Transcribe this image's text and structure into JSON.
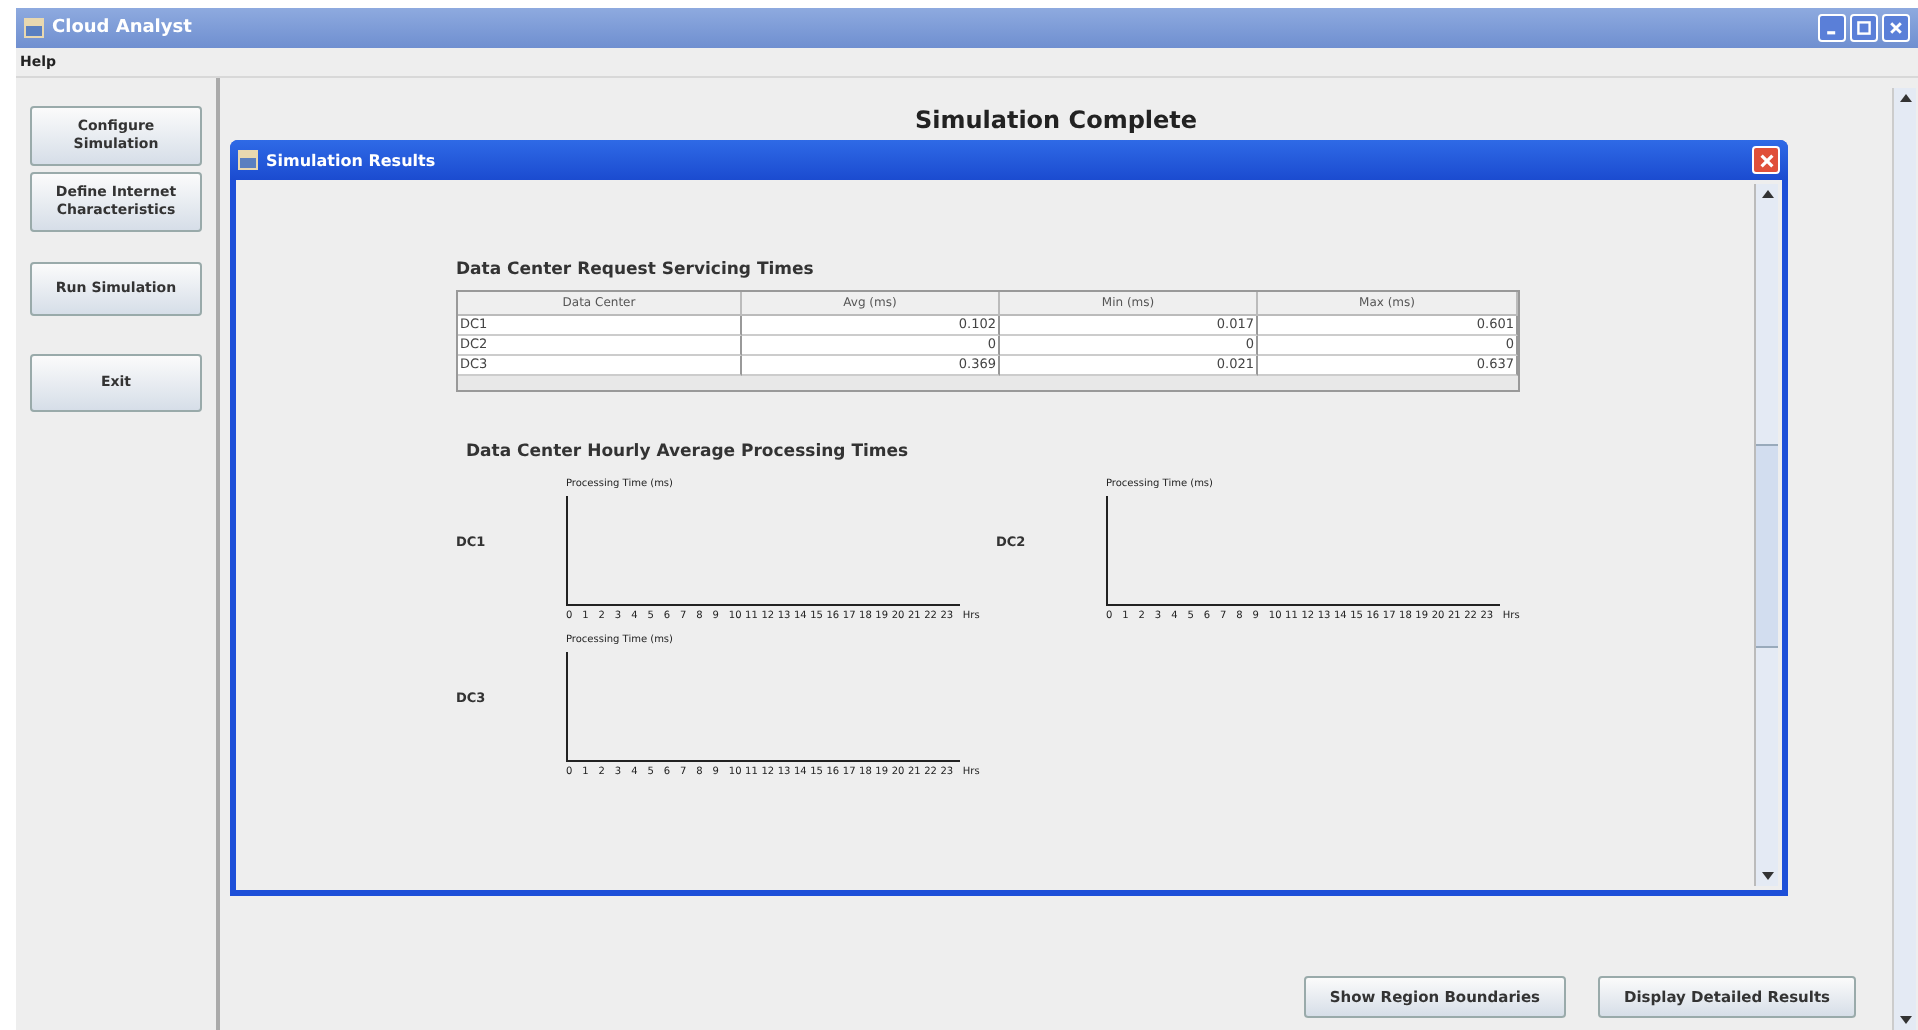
{
  "window": {
    "title": "Cloud Analyst"
  },
  "menu": [
    "Help"
  ],
  "sidebar_buttons": [
    "Configure Simulation",
    "Define Internet Characteristics",
    "Run Simulation",
    "Exit"
  ],
  "main_title": "Simulation Complete",
  "dialog": {
    "title": "Simulation Results",
    "servicing": {
      "title": "Data Center Request Servicing Times",
      "columns": [
        "Data Center",
        "Avg (ms)",
        "Min (ms)",
        "Max (ms)"
      ],
      "rows": [
        [
          "DC1",
          "0.102",
          "0.017",
          "0.601"
        ],
        [
          "DC2",
          "0",
          "0",
          "0"
        ],
        [
          "DC3",
          "0.369",
          "0.021",
          "0.637"
        ]
      ]
    },
    "hourly": {
      "title": "Data Center Hourly Average Processing Times",
      "charts": [
        {
          "label": "DC1",
          "y_title": "Processing Time (ms)",
          "x_unit": "Hrs",
          "x_ticks": [
            "0",
            "1",
            "2",
            "3",
            "4",
            "5",
            "6",
            "7",
            "8",
            "9",
            "10",
            "11",
            "12",
            "13",
            "14",
            "15",
            "16",
            "17",
            "18",
            "19",
            "20",
            "21",
            "22",
            "23"
          ]
        },
        {
          "label": "DC2",
          "y_title": "Processing Time (ms)",
          "x_unit": "Hrs",
          "x_ticks": [
            "0",
            "1",
            "2",
            "3",
            "4",
            "5",
            "6",
            "7",
            "8",
            "9",
            "10",
            "11",
            "12",
            "13",
            "14",
            "15",
            "16",
            "17",
            "18",
            "19",
            "20",
            "21",
            "22",
            "23"
          ]
        },
        {
          "label": "DC3",
          "y_title": "Processing Time (ms)",
          "x_unit": "Hrs",
          "x_ticks": [
            "0",
            "1",
            "2",
            "3",
            "4",
            "5",
            "6",
            "7",
            "8",
            "9",
            "10",
            "11",
            "12",
            "13",
            "14",
            "15",
            "16",
            "17",
            "18",
            "19",
            "20",
            "21",
            "22",
            "23"
          ]
        }
      ]
    }
  },
  "bottom_buttons": [
    "Show Region Boundaries",
    "Display Detailed Results"
  ]
}
